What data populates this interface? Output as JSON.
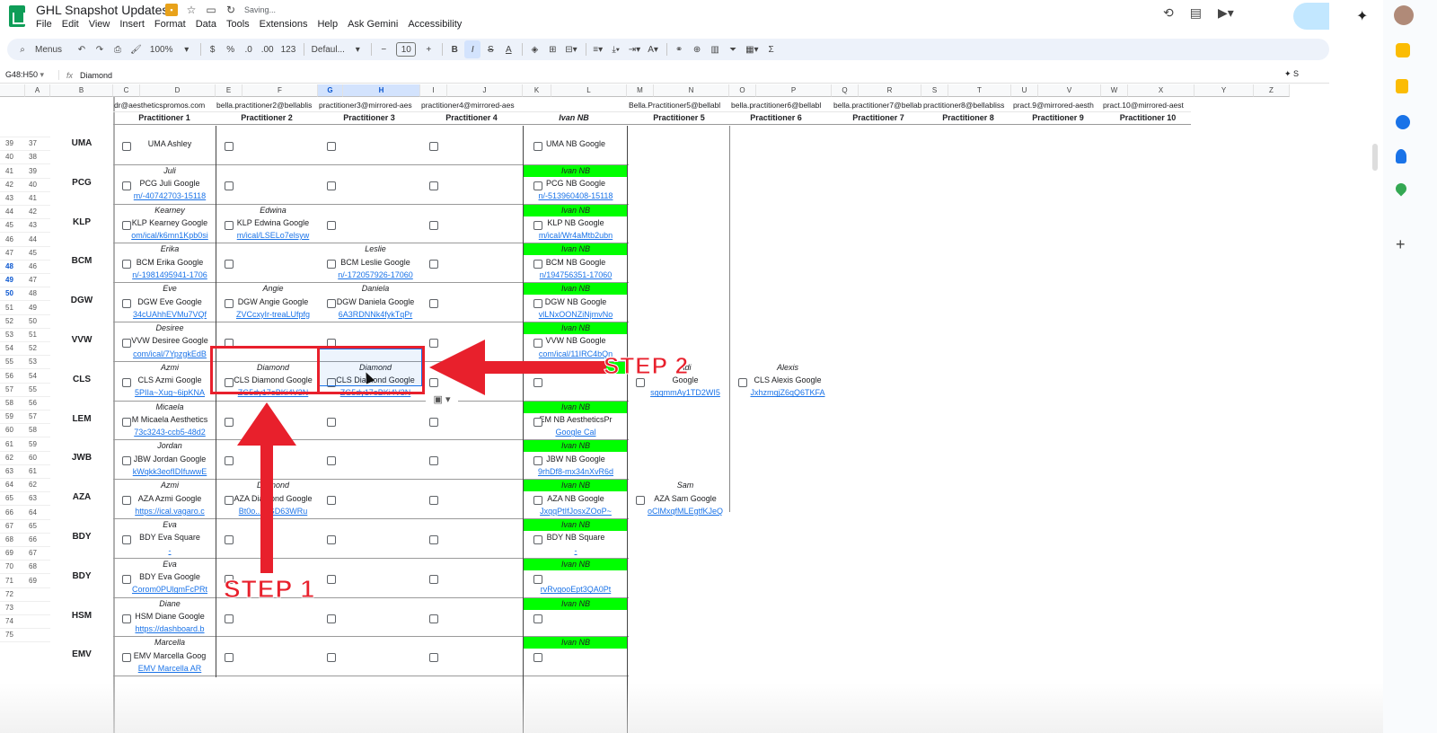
{
  "app": {
    "doc_title": "GHL Snapshot Updates",
    "saving_text": "Saving...",
    "menus": [
      "File",
      "Edit",
      "View",
      "Insert",
      "Format",
      "Data",
      "Tools",
      "Extensions",
      "Help",
      "Ask Gemini",
      "Accessibility"
    ]
  },
  "toolbar": {
    "search_label": "Menus",
    "zoom": "100%",
    "currency": "$",
    "percent": "%",
    "dec_less": ".0",
    "dec_more": ".00",
    "number_format": "123",
    "font": "Defaul...",
    "font_size": "10",
    "minus": "−",
    "plus": "+",
    "bold": "B",
    "italic": "I",
    "strike": "S",
    "text_color": "A",
    "sum": "Σ"
  },
  "formula_bar": {
    "name_box": "G48:H50",
    "fx": "fx",
    "content": "Diamond",
    "side_text": "S"
  },
  "columns": [
    "A",
    "B",
    "C",
    "D",
    "E",
    "F",
    "G",
    "H",
    "I",
    "J",
    "K",
    "L",
    "M",
    "N",
    "O",
    "P",
    "Q",
    "R",
    "S",
    "T",
    "U",
    "V",
    "W",
    "X",
    "Y",
    "Z"
  ],
  "header_emails": [
    "dr@aestheticspromos.com",
    "bella.practitioner2@bellablis",
    "practitioner3@mirrored-aes",
    "practitioner4@mirrored-aes",
    "Bella.Practitioner5@bellabl",
    "bella.practitioner6@bellabl",
    "bella.practitioner7@bellab",
    "practitioner8@bellabliss",
    "pract.9@mirrored-aesth",
    "pract.10@mirrored-aest"
  ],
  "practitioners": [
    "Practitioner 1",
    "Practitioner 2",
    "Practitioner 3",
    "Practitioner 4",
    "Ivan NB",
    "Practitioner 5",
    "Practitioner 6",
    "Practitioner 7",
    "Practitioner 8",
    "Practitioner 9",
    "Practitioner 10"
  ],
  "row_numbers": [
    [
      "",
      ""
    ],
    [
      "39",
      "37"
    ],
    [
      "40",
      "38"
    ],
    [
      "41",
      "39"
    ],
    [
      "42",
      "40"
    ],
    [
      "43",
      "41"
    ],
    [
      "44",
      "42"
    ],
    [
      "45",
      "43"
    ],
    [
      "46",
      "44"
    ],
    [
      "47",
      "45"
    ],
    [
      "48",
      "46"
    ],
    [
      "49",
      "47"
    ],
    [
      "50",
      "48"
    ],
    [
      "51",
      "49"
    ],
    [
      "52",
      "50"
    ],
    [
      "53",
      "51"
    ],
    [
      "54",
      "52"
    ],
    [
      "55",
      "53"
    ],
    [
      "56",
      "54"
    ],
    [
      "57",
      "55"
    ],
    [
      "58",
      "56"
    ],
    [
      "59",
      "57"
    ],
    [
      "60",
      "58"
    ],
    [
      "61",
      "59"
    ],
    [
      "62",
      "60"
    ],
    [
      "63",
      "61"
    ],
    [
      "64",
      "62"
    ],
    [
      "65",
      "63"
    ],
    [
      "66",
      "64"
    ],
    [
      "67",
      "65"
    ],
    [
      "68",
      "66"
    ],
    [
      "69",
      "67"
    ],
    [
      "70",
      "68"
    ],
    [
      "71",
      "69"
    ],
    [
      "72",
      ""
    ],
    [
      "73",
      ""
    ],
    [
      "74",
      ""
    ],
    [
      "75",
      ""
    ]
  ],
  "groups": [
    {
      "label": "UMA",
      "p1": [
        "",
        "UMA Ashley",
        ""
      ],
      "p2": [
        "",
        "",
        ""
      ],
      "p3": [
        "",
        "",
        ""
      ],
      "ivan": [
        "",
        "UMA NB Google",
        ""
      ],
      "ivan_green": false,
      "extra": []
    },
    {
      "label": "PCG",
      "p1": [
        "Juli",
        "PCG Juli Google",
        "m/-40742703-15118"
      ],
      "p2": [
        "",
        "",
        ""
      ],
      "p3": [
        "",
        "",
        ""
      ],
      "ivan": [
        "Ivan NB",
        "PCG NB Google",
        "n/-513960408-15118"
      ],
      "ivan_green": true,
      "extra": []
    },
    {
      "label": "KLP",
      "p1": [
        "Kearney",
        "KLP Kearney Google",
        "om/ical/k6mn1Kpb0si"
      ],
      "p2": [
        "Edwina",
        "KLP Edwina Google",
        "m/ical/LSELo7elsyw"
      ],
      "p3": [
        "",
        "",
        ""
      ],
      "ivan": [
        "Ivan NB",
        "KLP NB Google",
        "m/ical/Wr4aMtb2ubn"
      ],
      "ivan_green": true,
      "extra": []
    },
    {
      "label": "BCM",
      "p1": [
        "Erika",
        "BCM Erika Google",
        "n/-1981495941-1706"
      ],
      "p2": [
        "",
        "",
        ""
      ],
      "p3": [
        "Leslie",
        "BCM Leslie Google",
        "n/-172057926-17060"
      ],
      "ivan": [
        "Ivan NB",
        "BCM NB Google",
        "n/194756351-17060"
      ],
      "ivan_green": true,
      "extra": []
    },
    {
      "label": "DGW",
      "p1": [
        "Eve",
        "DGW Eve Google",
        "34cUAhhEVMu7VQf"
      ],
      "p2": [
        "Angie",
        "DGW Angie Google",
        "ZVCcxyIr-treaLUfpfg"
      ],
      "p3": [
        "Daniela",
        "DGW Daniela Google",
        "6A3RDNNk4fykTqPr"
      ],
      "ivan": [
        "Ivan NB",
        "DGW NB Google",
        "vlLNxOONZiNjmvNo"
      ],
      "ivan_green": true,
      "extra": []
    },
    {
      "label": "VVW",
      "p1": [
        "Desiree",
        "VVW Desiree Google",
        "com/ical/7YpzgkEdB"
      ],
      "p2": [
        "",
        "",
        ""
      ],
      "p3": [
        "",
        "",
        ""
      ],
      "ivan": [
        "Ivan NB",
        "VVW NB Google",
        "com/ical/11IRC4bQn"
      ],
      "ivan_green": true,
      "extra": []
    },
    {
      "label": "CLS",
      "p1": [
        "Azmi",
        "CLS Azmi Google",
        "5PIIa~Xug~6ipKNA"
      ],
      "p2": [
        "Diamond",
        "CLS Diamond Google",
        "ZG5dy17eBKi4V3N"
      ],
      "p3": [
        "Diamond",
        "CLS Diamond Google",
        "ZG5dy17eBKi4V3N"
      ],
      "ivan": [
        "Ivan NB",
        "",
        ""
      ],
      "ivan_green": true,
      "extra": [
        {
          "col": "p5",
          "lines": [
            "Adi",
            "Google",
            "sgqmmAy1TD2WI5"
          ]
        },
        {
          "col": "p6",
          "lines": [
            "Alexis",
            "CLS Alexis Google",
            "JxhzmqjZ6qQ6TKFA"
          ]
        }
      ]
    },
    {
      "label": "LEM",
      "p1": [
        "Micaela",
        "M Micaela Aesthetics",
        "73c3243-ccb5-48d2"
      ],
      "p2": [
        "",
        "",
        ""
      ],
      "p3": [
        "",
        "",
        ""
      ],
      "ivan": [
        "Ivan NB",
        "EM NB AestheticsPr",
        "Google Cal"
      ],
      "ivan_green": true,
      "extra": []
    },
    {
      "label": "JWB",
      "p1": [
        "Jordan",
        "JBW Jordan Google",
        "kWqkk3eofIDIfuwwE"
      ],
      "p2": [
        "",
        "",
        ""
      ],
      "p3": [
        "",
        "",
        ""
      ],
      "ivan": [
        "Ivan NB",
        "JBW NB Google",
        "9rhDf8-mx34nXvR6d"
      ],
      "ivan_green": true,
      "extra": []
    },
    {
      "label": "AZA",
      "p1": [
        "Azmi",
        "AZA Azmi Google",
        "https://ical.vagaro.c"
      ],
      "p2": [
        "Diamond",
        "AZA Diamond Google",
        "Bt0o...hjGD63WRu"
      ],
      "p3": [
        "",
        "",
        ""
      ],
      "ivan": [
        "Ivan NB",
        "AZA NB Google",
        "JxqqPtIfJosxZOoP~"
      ],
      "ivan_green": true,
      "extra": [
        {
          "col": "p5",
          "lines": [
            "Sam",
            "AZA Sam Google",
            "oClMxqfMLEgtfKJeQ"
          ]
        }
      ]
    },
    {
      "label": "BDY",
      "p1": [
        "Eva",
        "BDY Eva Square",
        "-"
      ],
      "p2": [
        "",
        "",
        ""
      ],
      "p3": [
        "",
        "",
        ""
      ],
      "ivan": [
        "Ivan NB",
        "BDY NB Square",
        "-"
      ],
      "ivan_green": true,
      "extra": []
    },
    {
      "label": "BDY",
      "p1": [
        "Eva",
        "BDY Eva Google",
        "Corom0PUlgmFcPRt"
      ],
      "p2": [
        "",
        "",
        ""
      ],
      "p3": [
        "",
        "",
        ""
      ],
      "ivan": [
        "Ivan NB",
        "",
        "rvRvgooEpt3QA0Pt"
      ],
      "ivan_green": true,
      "extra": []
    },
    {
      "label": "HSM",
      "p1": [
        "Diane",
        "HSM Diane Google",
        "https://dashboard.b"
      ],
      "p2": [
        "",
        "",
        ""
      ],
      "p3": [
        "",
        "",
        ""
      ],
      "ivan": [
        "Ivan NB",
        "",
        ""
      ],
      "ivan_green": true,
      "extra": []
    },
    {
      "label": "EMV",
      "p1": [
        "Marcella",
        "EMV Marcella Goog",
        "EMV Marcella AR"
      ],
      "p2": [
        "",
        "",
        ""
      ],
      "p3": [
        "",
        "",
        ""
      ],
      "ivan": [
        "Ivan NB",
        "",
        ""
      ],
      "ivan_green": true,
      "extra": []
    }
  ],
  "annotations": {
    "step1": "STEP 1",
    "step2": "STEP 2",
    "color": "#e8202c"
  },
  "colors": {
    "green_fill": "#00ff00",
    "link": "#1a73e8",
    "selection": "#1a73e8"
  },
  "sidebar_icons": [
    "gemini-icon",
    "avatar",
    "sheets-icon",
    "keep-icon",
    "tasks-icon",
    "contacts-icon",
    "maps-icon",
    "add-icon"
  ]
}
